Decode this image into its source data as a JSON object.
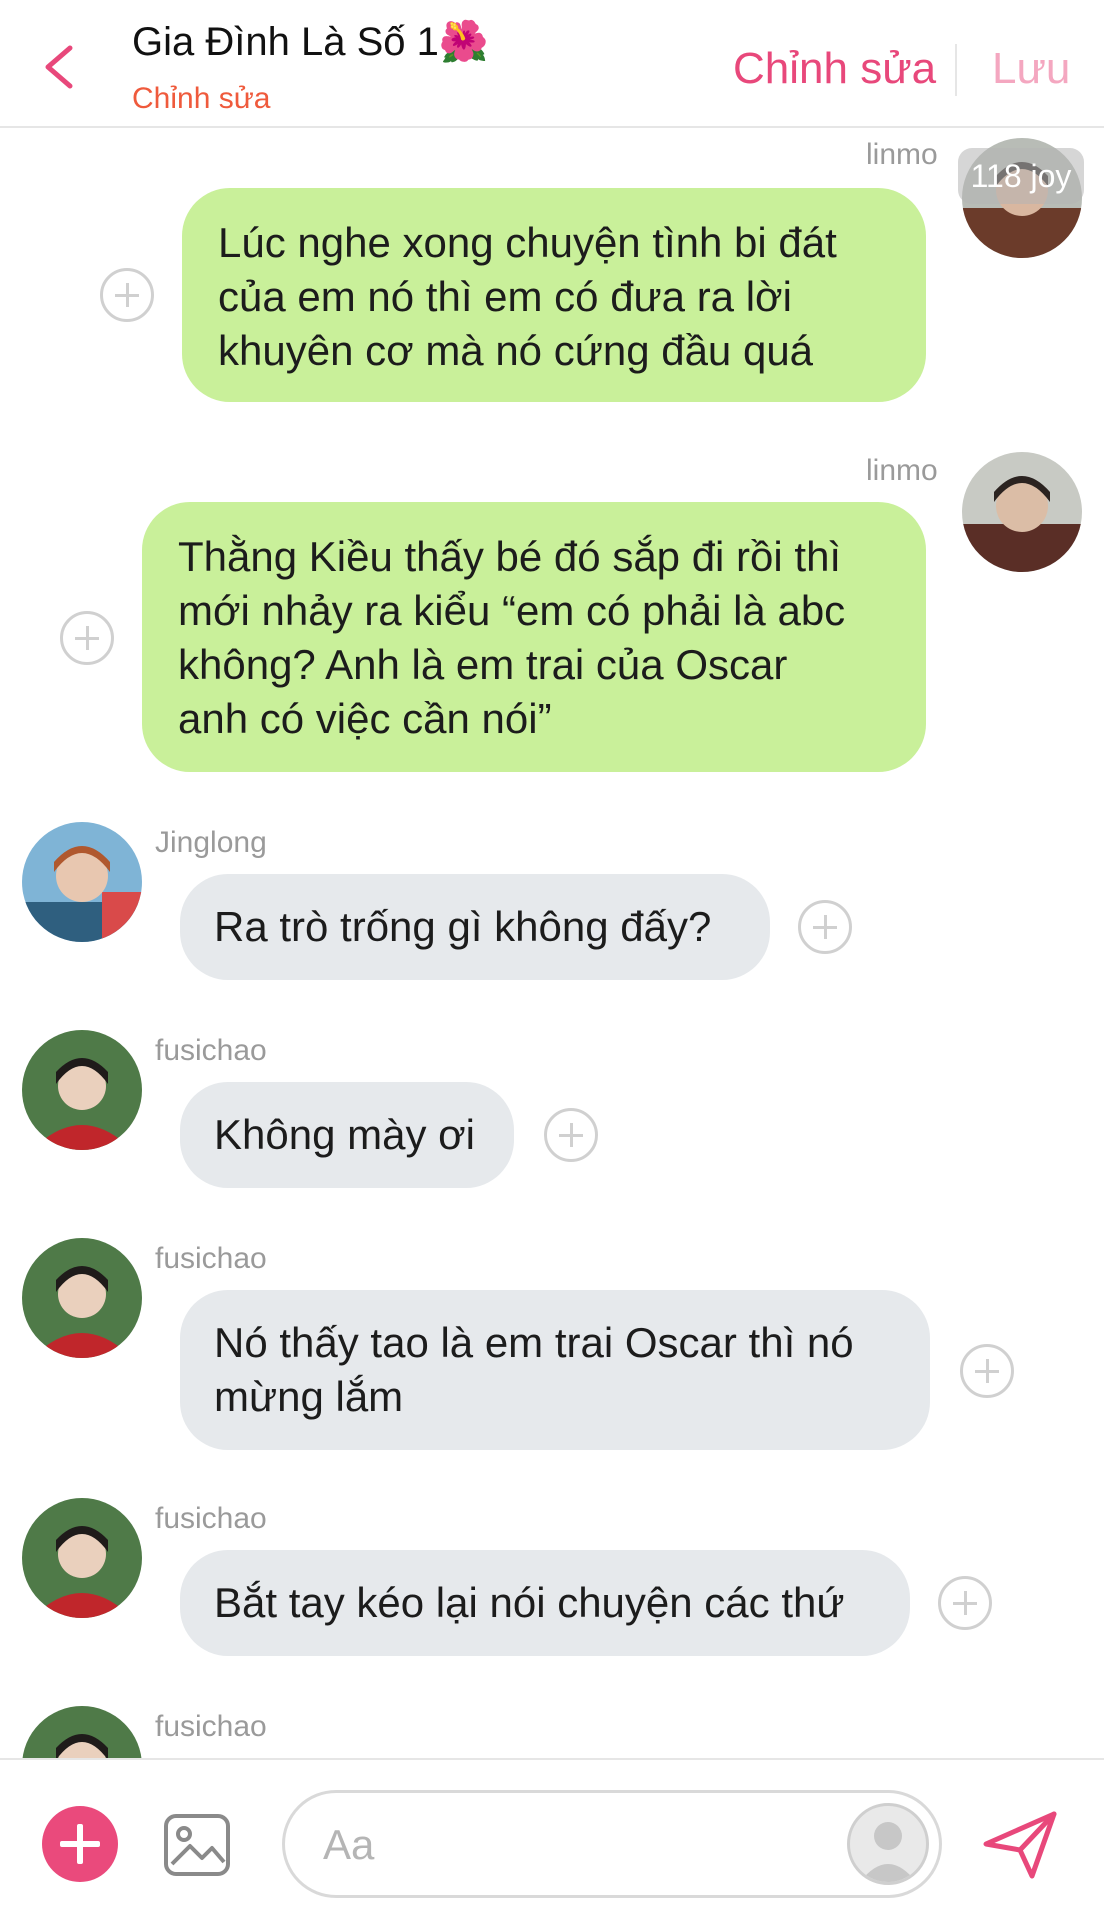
{
  "header": {
    "title": "Gia Đình Là Số 1🌺",
    "subtitle": "Chỉnh sửa",
    "edit_label": "Chỉnh sửa",
    "save_label": "Lưu"
  },
  "overlay_label": "118 joy",
  "messages": [
    {
      "sender": "linmo",
      "side": "right",
      "lines": [
        "Lúc nghe xong chuyện tình bi đát",
        "của em nó thì em có đưa ra lời",
        "khuyên cơ mà nó cứng đầu quá"
      ]
    },
    {
      "sender": "linmo",
      "side": "right",
      "lines": [
        "Thằng Kiều thấy bé đó sắp đi rồi thì",
        "mới nhảy ra kiểu “em có phải là abc",
        "không? Anh là em trai của Oscar",
        "anh có việc cần nói”"
      ]
    },
    {
      "sender": "Jinglong",
      "side": "left",
      "lines": [
        "Ra trò trống gì không đấy?"
      ]
    },
    {
      "sender": "fusichao",
      "side": "left",
      "lines": [
        "Không mày ơi"
      ]
    },
    {
      "sender": "fusichao",
      "side": "left",
      "lines": [
        "Nó thấy tao là em trai Oscar thì nó",
        "mừng lắm"
      ]
    },
    {
      "sender": "fusichao",
      "side": "left",
      "lines": [
        "Bắt tay kéo lại nói chuyện các thứ"
      ]
    },
    {
      "sender": "fusichao",
      "side": "left",
      "lines": []
    }
  ],
  "composer": {
    "placeholder": "Aa"
  },
  "colors": {
    "accent": "#e8487b",
    "outgoing_bubble": "#c9f09a",
    "incoming_bubble": "#e6e9ec",
    "subtitle": "#ef5a3c"
  },
  "icons": [
    "back-chevron-icon",
    "plus-circle-icon",
    "image-icon",
    "send-icon",
    "add-icon"
  ]
}
